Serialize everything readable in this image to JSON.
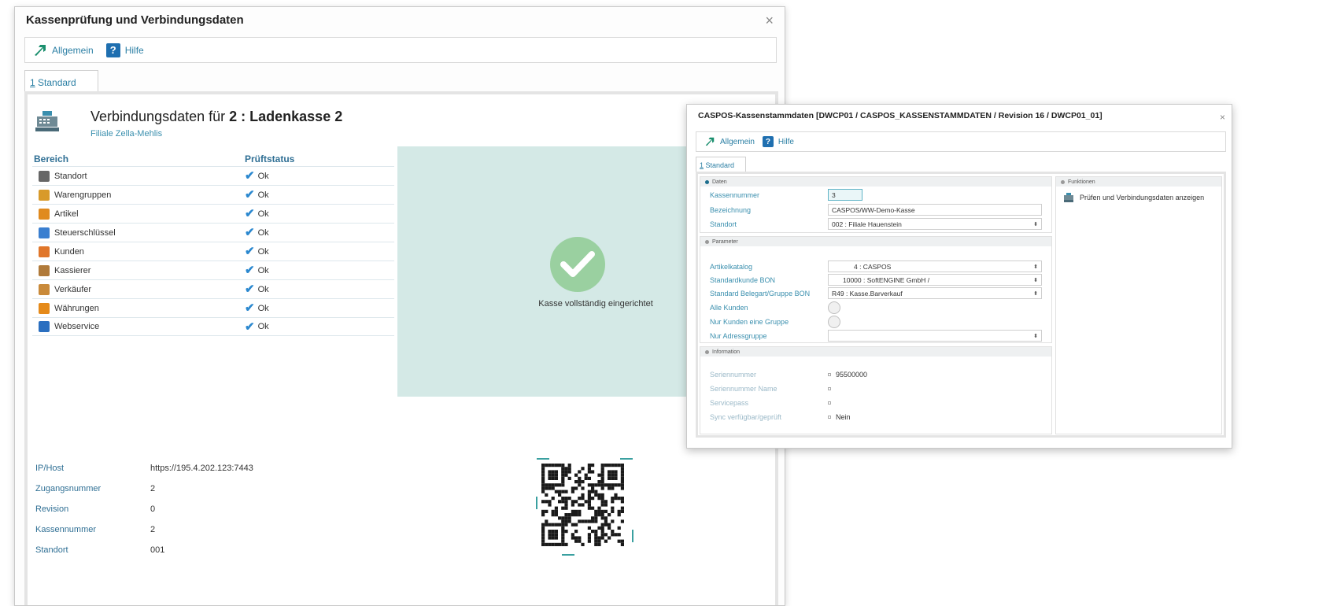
{
  "main_dialog": {
    "title": "Kassenprüfung und Verbindungsdaten",
    "close": "×",
    "toolbar": {
      "allgemein": "Allgemein",
      "hilfe": "Hilfe",
      "help_glyph": "?"
    },
    "tab": {
      "number": "1",
      "label": " Standard"
    },
    "header": {
      "prefix": "Verbindungsdaten für ",
      "bold": "2 : Ladenkasse 2",
      "subtitle": "Filiale Zella-Mehlis"
    },
    "table": {
      "col_bereich": "Bereich",
      "col_status": "Prüftstatus",
      "rows": [
        {
          "name": "Standort",
          "status": "Ok",
          "icon": "map-pin-icon",
          "color": "#666666"
        },
        {
          "name": "Warengruppen",
          "status": "Ok",
          "icon": "goods-basket-icon",
          "color": "#d89a2a"
        },
        {
          "name": "Artikel",
          "status": "Ok",
          "icon": "article-icon",
          "color": "#e08a1e"
        },
        {
          "name": "Steuerschlüssel",
          "status": "Ok",
          "icon": "tax-key-icon",
          "color": "#3a7fd0"
        },
        {
          "name": "Kunden",
          "status": "Ok",
          "icon": "customer-icon",
          "color": "#e0762a"
        },
        {
          "name": "Kassierer",
          "status": "Ok",
          "icon": "cashier-icon",
          "color": "#b07a3a"
        },
        {
          "name": "Verkäufer",
          "status": "Ok",
          "icon": "seller-icon",
          "color": "#c98a3a"
        },
        {
          "name": "Währungen",
          "status": "Ok",
          "icon": "currency-icon",
          "color": "#e58a1a"
        },
        {
          "name": "Webservice",
          "status": "Ok",
          "icon": "webservice-icon",
          "color": "#2a6fc0"
        }
      ]
    },
    "result_message": "Kasse vollständig eingerichtet",
    "connection": [
      {
        "key": "IP/Host",
        "value": "https://195.4.202.123:7443"
      },
      {
        "key": "Zugangsnummer",
        "value": "2"
      },
      {
        "key": "Revision",
        "value": "0"
      },
      {
        "key": "Kassennummer",
        "value": "2"
      },
      {
        "key": "Standort",
        "value": "001"
      }
    ]
  },
  "second_dialog": {
    "title": "CASPOS-Kassenstammdaten [DWCP01 / CASPOS_KASSENSTAMMDATEN / Revision 16 / DWCP01_01]",
    "close": "×",
    "toolbar": {
      "allgemein": "Allgemein",
      "hilfe": "Hilfe",
      "help_glyph": "?"
    },
    "tab": {
      "number": "1",
      "label": " Standard"
    },
    "daten": {
      "title": "Daten",
      "kassennummer_label": "Kassennummer",
      "kassennummer_value": "3",
      "bezeichnung_label": "Bezeichnung",
      "bezeichnung_value": "CASPOS/WW-Demo-Kasse",
      "standort_label": "Standort",
      "standort_value": "002   : Filiale Hauenstein"
    },
    "parameter": {
      "title": "Parameter",
      "artikelkatalog_label": "Artikelkatalog",
      "artikelkatalog_value": "4   : CASPOS",
      "standardkunde_label": "Standardkunde BON",
      "standardkunde_value": "10000   : SoftENGINE GmbH /",
      "belegart_label": "Standard Belegart/Gruppe BON",
      "belegart_value": "R49   : Kasse.Barverkauf",
      "alle_kunden_label": "Alle Kunden",
      "nur_kunden_label": "Nur Kunden eine Gruppe",
      "nur_adress_label": "Nur Adressgruppe",
      "nur_adress_value": ""
    },
    "information": {
      "title": "Information",
      "seriennummer_label": "Seriennummer",
      "seriennummer_value": "95500000",
      "seriennummer_name_label": "Seriennummer Name",
      "servicepass_label": "Servicepass",
      "sync_label": "Sync verfügbar/geprüft",
      "sync_value": "Nein"
    },
    "funktionen": {
      "title": "Funktionen",
      "action": "Prüfen und Verbindungsdaten anzeigen"
    }
  }
}
